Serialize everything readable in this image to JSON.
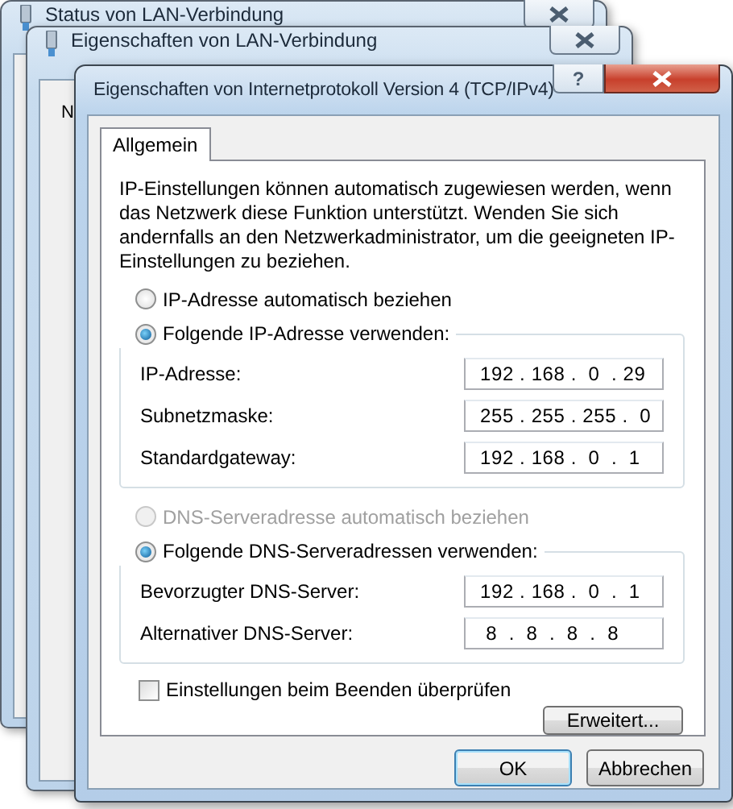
{
  "background_windows": [
    {
      "title": "Status von LAN-Verbindung"
    },
    {
      "title": "Eigenschaften von LAN-Verbindung",
      "tab_label": "N"
    }
  ],
  "dialog": {
    "title": "Eigenschaften von Internetprotokoll Version 4 (TCP/IPv4)",
    "help_button": "?",
    "tabs": [
      {
        "label": "Allgemein",
        "selected": true
      }
    ],
    "description": "IP-Einstellungen können automatisch zugewiesen werden, wenn das Netzwerk diese Funktion unterstützt. Wenden Sie sich andernfalls an den Netzwerkadministrator, um die geeigneten IP-Einstellungen zu beziehen.",
    "ip_auto": {
      "label": "IP-Adresse automatisch beziehen",
      "selected": false,
      "disabled": false
    },
    "ip_manual": {
      "label": "Folgende IP-Adresse verwenden:",
      "selected": true,
      "disabled": false
    },
    "ip_fields": [
      {
        "label": "IP-Adresse:",
        "value": "192 . 168 .  0  . 29"
      },
      {
        "label": "Subnetzmaske:",
        "value": "255 . 255 . 255 .  0"
      },
      {
        "label": "Standardgateway:",
        "value": "192 . 168 .  0  .  1"
      }
    ],
    "dns_auto": {
      "label": "DNS-Serveradresse automatisch beziehen",
      "selected": false,
      "disabled": true
    },
    "dns_manual": {
      "label": "Folgende DNS-Serveradressen verwenden:",
      "selected": true,
      "disabled": false
    },
    "dns_fields": [
      {
        "label": "Bevorzugter DNS-Server:",
        "value": "192 . 168 .  0  .  1"
      },
      {
        "label": "Alternativer DNS-Server:",
        "value": " 8  .  8  .  8  .  8"
      }
    ],
    "validate_on_exit": {
      "label": "Einstellungen beim Beenden überprüfen",
      "checked": false
    },
    "advanced_button": "Erweitert...",
    "buttons": [
      {
        "label": "OK",
        "default": true
      },
      {
        "label": "Abbrechen",
        "default": false
      }
    ]
  }
}
